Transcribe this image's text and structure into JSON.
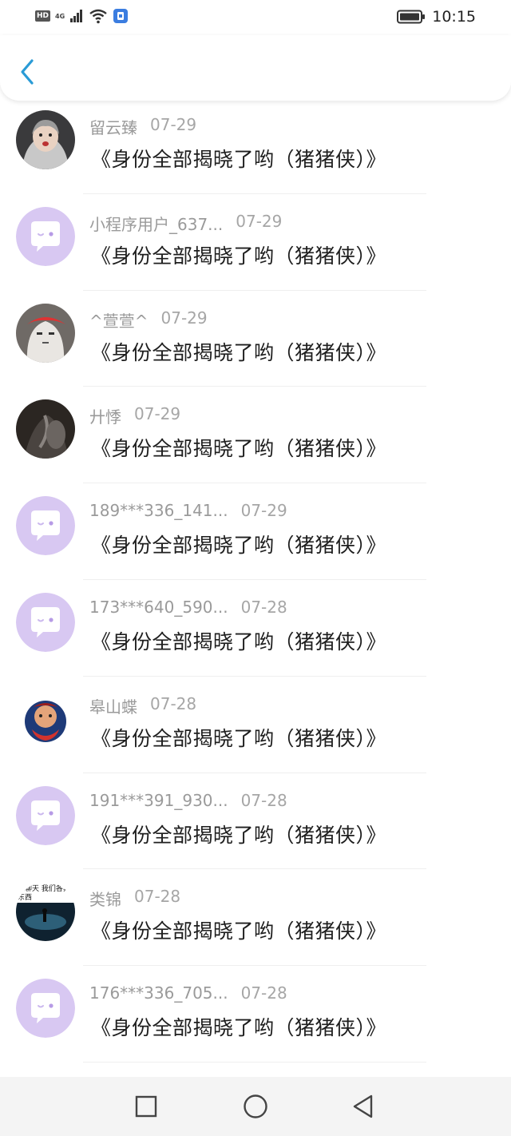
{
  "status_bar": {
    "hd": "HD",
    "network": "4G",
    "time": "10:15"
  },
  "header": {
    "back_icon": "chevron-left-icon",
    "accent": "#2a9bd6"
  },
  "items": [
    {
      "name": "留云臻",
      "date": "07-29",
      "title": "《身份全部揭晓了哟（猪猪侠）》",
      "avatar": "photo"
    },
    {
      "name": "小程序用户_637...",
      "date": "07-29",
      "title": "《身份全部揭晓了哟（猪猪侠）》",
      "avatar": "default"
    },
    {
      "name": "^萱萱^",
      "date": "07-29",
      "title": "《身份全部揭晓了哟（猪猪侠）》",
      "avatar": "photo"
    },
    {
      "name": "廾悸",
      "date": "07-29",
      "title": "《身份全部揭晓了哟（猪猪侠）》",
      "avatar": "photo"
    },
    {
      "name": "189***336_141...",
      "date": "07-29",
      "title": "《身份全部揭晓了哟（猪猪侠）》",
      "avatar": "default"
    },
    {
      "name": "173***640_590...",
      "date": "07-28",
      "title": "《身份全部揭晓了哟（猪猪侠）》",
      "avatar": "default"
    },
    {
      "name": "皋山蝶",
      "date": "07-28",
      "title": "《身份全部揭晓了哟（猪猪侠）》",
      "avatar": "photo"
    },
    {
      "name": "191***391_930...",
      "date": "07-28",
      "title": "《身份全部揭晓了哟（猪猪侠）》",
      "avatar": "default"
    },
    {
      "name": "类锦",
      "date": "07-28",
      "title": "《身份全部揭晓了哟（猪猪侠）》",
      "avatar": "photo",
      "avatar_caption": "业聊天 我们各奔东西"
    },
    {
      "name": "176***336_705...",
      "date": "07-28",
      "title": "《身份全部揭晓了哟（猪猪侠）》",
      "avatar": "default"
    }
  ],
  "nav": {
    "recent_icon": "square-icon",
    "home_icon": "circle-icon",
    "back_icon": "triangle-back-icon"
  }
}
